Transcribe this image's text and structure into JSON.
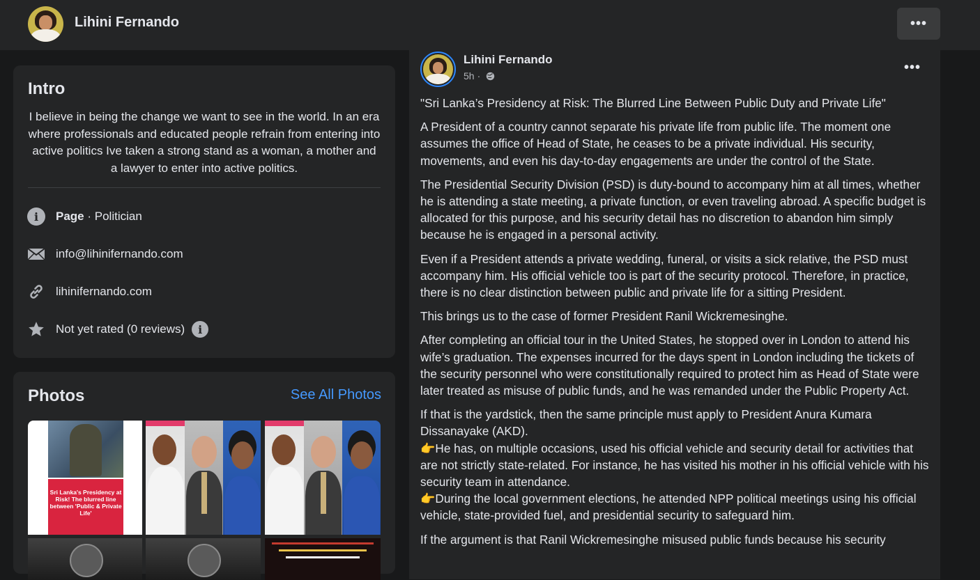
{
  "header": {
    "name": "Lihini Fernando",
    "more_label": "•••"
  },
  "intro": {
    "title": "Intro",
    "bio": "I believe in being the change we want to see in the world. In an era where professionals and educated people refrain from entering into active politics Ive taken a strong stand as a woman, a mother and a lawyer to enter into active politics.",
    "page_label": "Page",
    "page_category": " · Politician",
    "email": "info@lihinifernando.com",
    "website": "lihinifernando.com",
    "rating": "Not yet rated (0 reviews)"
  },
  "photos": {
    "title": "Photos",
    "see_all": "See All Photos",
    "photo1_caption": "Sri Lanka's Presidency at Risk! The blurred line between 'Public & Private Life'"
  },
  "post": {
    "author": "Lihini Fernando",
    "time": "5h",
    "separator": "·",
    "more_label": "•••",
    "paragraphs": {
      "p0": "\"Sri Lanka’s Presidency at Risk: The Blurred Line Between Public Duty and Private Life\"",
      "p1": "A President of a country cannot separate his private life from public life. The moment one assumes the office of Head of State, he ceases to be a private individual. His security, movements, and even his day-to-day engagements are under the control of the State.",
      "p2": "The Presidential Security Division (PSD) is duty-bound to accompany him at all times, whether he is attending a state meeting, a private function, or even traveling abroad. A specific budget is allocated for this purpose, and his security detail has no discretion to abandon him simply because he is engaged in a personal activity.",
      "p3": "Even if a President attends a private wedding, funeral, or visits a sick relative, the PSD must accompany him. His official vehicle too is part of the security protocol. Therefore, in practice, there is no clear distinction between public and private life for a sitting President.",
      "p4": "This brings us to the case of former President Ranil Wickremesinghe.",
      "p5": "After completing an official tour in the United States, he stopped over in London to attend his wife’s graduation. The expenses incurred for the days spent in London including the tickets of the security personnel who were constitutionally required to protect him as Head of State were later treated as misuse of public funds, and he was remanded under the Public Property Act.",
      "p6": "If that is the yardstick, then the same principle must apply to President Anura Kumara Dissanayake (AKD).",
      "p7": "He has, on multiple occasions, used his official vehicle and security detail for activities that are not strictly state-related. For instance, he has visited his mother in his official vehicle with his security team in attendance.",
      "p8": "During the local government elections, he attended NPP political meetings using his official vehicle, state-provided fuel, and presidential security to safeguard him.",
      "p9": "If the argument is that Ranil Wickremesinghe misused public funds because his security"
    },
    "pointer_emoji": "👉"
  }
}
